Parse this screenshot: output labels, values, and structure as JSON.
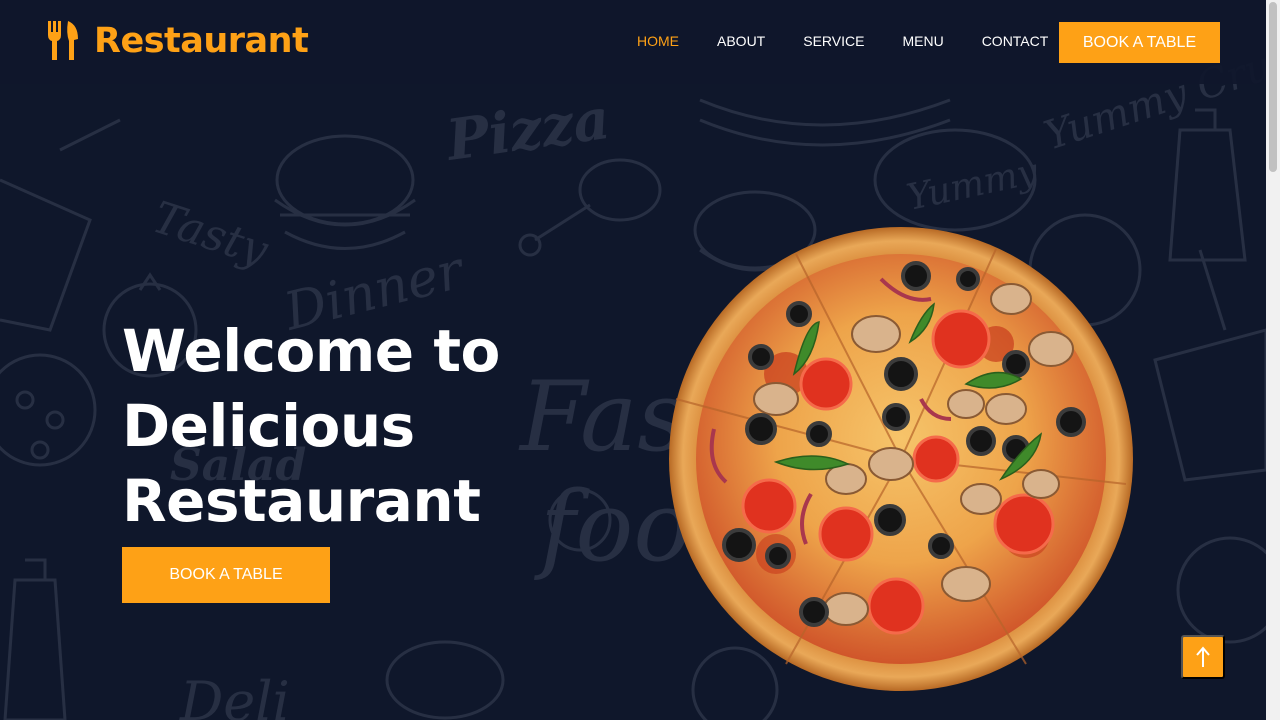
{
  "brand": {
    "name": "Restaurant",
    "icon": "utensils-icon",
    "color": "#fea116"
  },
  "nav": {
    "items": [
      {
        "label": "HOME",
        "active": true
      },
      {
        "label": "ABOUT",
        "active": false
      },
      {
        "label": "SERVICE",
        "active": false
      },
      {
        "label": "MENU",
        "active": false
      },
      {
        "label": "CONTACT",
        "active": false
      }
    ],
    "cta_label": "BOOK A TABLE"
  },
  "hero": {
    "title_lines": [
      "Welcome to",
      "Delicious",
      "Restaurant"
    ],
    "cta_label": "BOOK A TABLE",
    "image": "pizza-image"
  },
  "back_to_top": {
    "icon": "arrow-up-icon"
  },
  "colors": {
    "accent": "#fea116",
    "background": "#0f172b",
    "text": "#ffffff"
  }
}
